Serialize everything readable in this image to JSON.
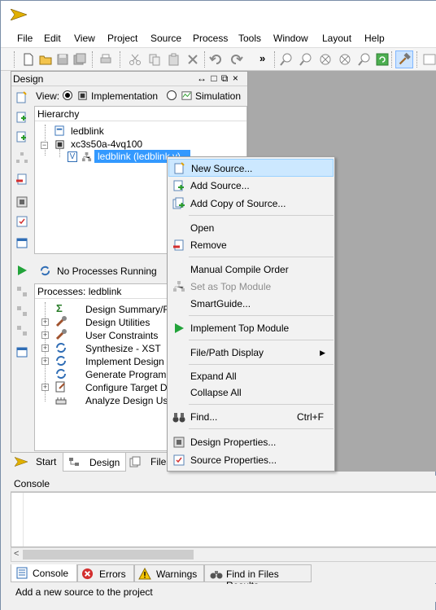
{
  "menubar": [
    "File",
    "Edit",
    "View",
    "Project",
    "Source",
    "Process",
    "Tools",
    "Window",
    "Layout",
    "Help"
  ],
  "design_panel": {
    "title": "Design",
    "controls": "↔ □ ⧉ ×",
    "view_label": "View:",
    "view_implementation": "Implementation",
    "view_simulation": "Simulation",
    "hierarchy_header": "Hierarchy",
    "tree": {
      "root": "ledblink",
      "device": "xc3s50a-4vq100",
      "module": "ledblink (ledblink.v)"
    }
  },
  "processes": {
    "status": "No Processes Running",
    "header": "Processes: ledblink",
    "items": [
      "Design Summary/R",
      "Design Utilities",
      "User Constraints",
      "Synthesize - XST",
      "Implement Design",
      "Generate Programm",
      "Configure Target De",
      "Analyze Design Usin"
    ]
  },
  "bottom_tabs": [
    "Start",
    "Design",
    "Files"
  ],
  "context_menu": {
    "items": [
      {
        "label": "New Source...",
        "icon": "new-source-icon"
      },
      {
        "label": "Add Source...",
        "icon": "add-source-icon"
      },
      {
        "label": "Add Copy of Source...",
        "icon": "add-copy-icon"
      },
      {
        "label": "Open"
      },
      {
        "label": "Remove",
        "icon": "remove-icon"
      },
      {
        "label": "Manual Compile Order"
      },
      {
        "label": "Set as Top Module",
        "icon": "hierarchy-icon"
      },
      {
        "label": "SmartGuide..."
      },
      {
        "label": "Implement Top Module",
        "icon": "play-icon"
      },
      {
        "label": "File/Path Display",
        "arrow": "▶"
      },
      {
        "label": "Expand All"
      },
      {
        "label": "Collapse All"
      },
      {
        "label": "Find...",
        "icon": "binoculars-icon",
        "shortcut": "Ctrl+F"
      },
      {
        "label": "Design Properties...",
        "icon": "design-properties-icon"
      },
      {
        "label": "Source Properties...",
        "icon": "source-properties-icon"
      }
    ]
  },
  "console": {
    "title": "Console",
    "tabs": [
      "Console",
      "Errors",
      "Warnings",
      "Find in Files Results"
    ]
  },
  "status_bar": "Add a new source to the project",
  "colors": {
    "highlight": "#cce8ff",
    "workspace_grey": "#a9a9a9",
    "selection": "#3399ff"
  }
}
